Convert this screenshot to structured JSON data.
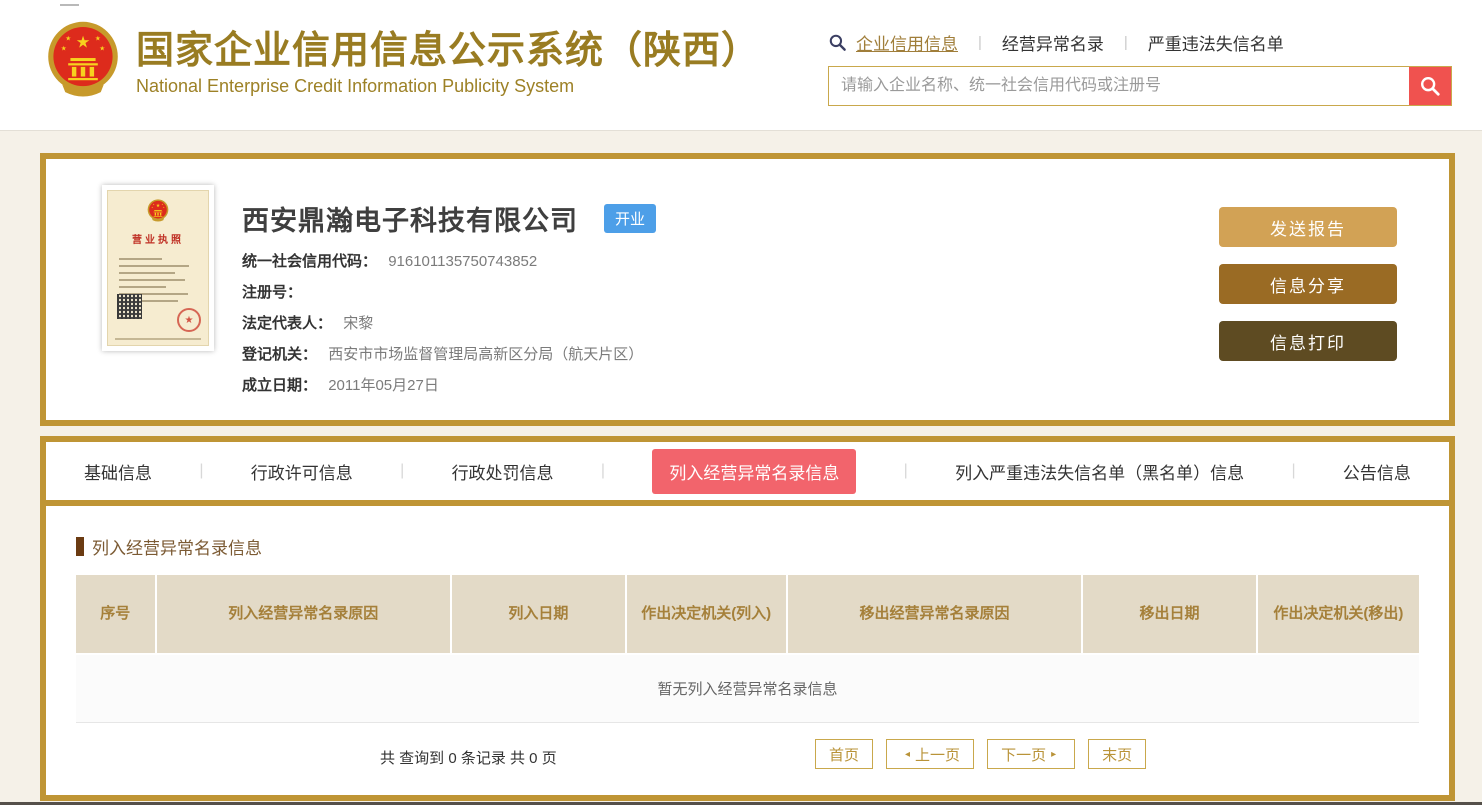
{
  "header": {
    "title": "国家企业信用信息公示系统（陕西）",
    "subtitle": "National Enterprise Credit Information Publicity System",
    "nav_links": [
      {
        "label": "企业信用信息",
        "active": true
      },
      {
        "label": "经营异常名录",
        "active": false
      },
      {
        "label": "严重违法失信名单",
        "active": false
      }
    ],
    "search": {
      "placeholder": "请输入企业名称、统一社会信用代码或注册号",
      "value": ""
    }
  },
  "company": {
    "name": "西安鼎瀚电子科技有限公司",
    "status": "开业",
    "license_thumb_title": "营业执照",
    "fields": [
      {
        "label": "统一社会信用代码：",
        "value": "916101135750743852"
      },
      {
        "label": "注册号：",
        "value": ""
      },
      {
        "label": "法定代表人：",
        "value": "宋黎"
      },
      {
        "label": "登记机关：",
        "value": "西安市市场监督管理局高新区分局（航天片区）"
      },
      {
        "label": "成立日期：",
        "value": "2011年05月27日"
      }
    ],
    "actions": [
      {
        "label": "发送报告",
        "color": "#d2a255"
      },
      {
        "label": "信息分享",
        "color": "#9a6b24"
      },
      {
        "label": "信息打印",
        "color": "#5e4b22"
      }
    ]
  },
  "tabs": [
    {
      "label": "基础信息",
      "active": false
    },
    {
      "label": "行政许可信息",
      "active": false
    },
    {
      "label": "行政处罚信息",
      "active": false
    },
    {
      "label": "列入经营异常名录信息",
      "active": true
    },
    {
      "label": "列入严重违法失信名单（黑名单）信息",
      "active": false
    },
    {
      "label": "公告信息",
      "active": false
    }
  ],
  "abnormal_section": {
    "title": "列入经营异常名录信息",
    "table": {
      "headers": [
        "序号",
        "列入经营异常名录原因",
        "列入日期",
        "作出决定机关(列入)",
        "移出经营异常名录原因",
        "移出日期",
        "作出决定机关(移出)"
      ],
      "empty_message": "暂无列入经营异常名录信息"
    },
    "record_summary": "共 查询到 0 条记录 共 0 页",
    "pagination": {
      "first": "首页",
      "prev": "上一页",
      "next": "下一页",
      "last": "末页",
      "prev_arrow": "◂",
      "next_arrow": "▸"
    }
  },
  "icons": {
    "nav_search": "magnifier",
    "search_button": "magnifier",
    "logo": "china-national-emblem"
  },
  "colors": {
    "brand_gold": "#997c22",
    "card_border": "#bf9535",
    "active_tab": "#f2646c",
    "status_badge": "#4d9fe8",
    "table_header_bg": "#e3dac7",
    "table_header_text": "#a5803a",
    "search_button": "#f0524f",
    "active_link": "#a07e3a"
  }
}
